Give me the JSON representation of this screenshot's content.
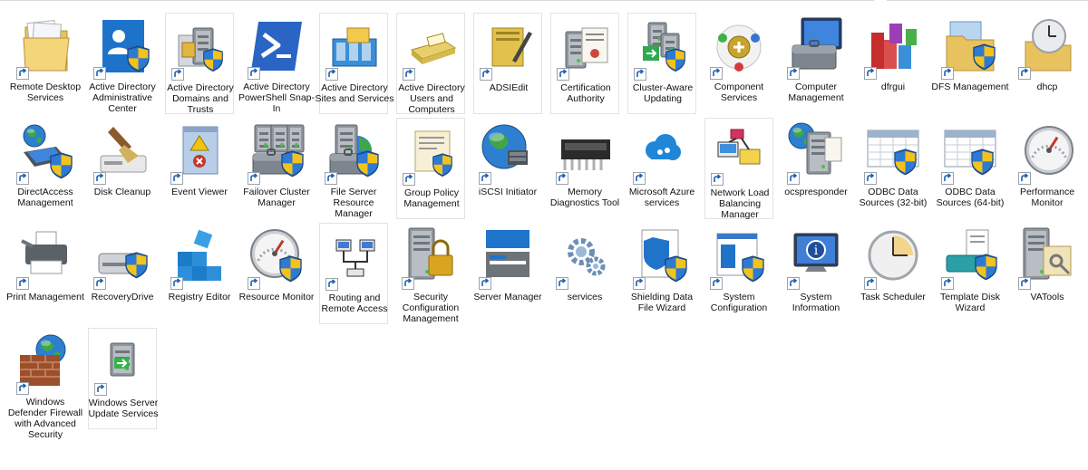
{
  "items": [
    {
      "label": "Remote Desktop Services",
      "icon": "folder-icon"
    },
    {
      "label": "Active Directory Administrative Center",
      "icon": "admin-center-icon"
    },
    {
      "label": "Active Directory Domains and Trusts",
      "icon": "domains-trusts-icon"
    },
    {
      "label": "Active Directory PowerShell Snap-In",
      "icon": "powershell-icon"
    },
    {
      "label": "Active Directory Sites and Services",
      "icon": "sites-services-icon"
    },
    {
      "label": "Active Directory Users and Computers",
      "icon": "users-computers-icon"
    },
    {
      "label": "ADSIEdit",
      "icon": "adsiedit-icon"
    },
    {
      "label": "Certification Authority",
      "icon": "certificate-server-icon"
    },
    {
      "label": "Cluster-Aware Updating",
      "icon": "cluster-update-icon"
    },
    {
      "label": "Component Services",
      "icon": "component-services-icon"
    },
    {
      "label": "Computer Management",
      "icon": "computer-management-icon"
    },
    {
      "label": "dfrgui",
      "icon": "defrag-icon"
    },
    {
      "label": "DFS Management",
      "icon": "dfs-folder-icon"
    },
    {
      "label": "dhcp",
      "icon": "dhcp-clock-folder-icon"
    },
    {
      "label": "DirectAccess Management",
      "icon": "laptop-globe-icon"
    },
    {
      "label": "Disk Cleanup",
      "icon": "disk-cleanup-icon"
    },
    {
      "label": "Event Viewer",
      "icon": "event-viewer-icon"
    },
    {
      "label": "Failover Cluster Manager",
      "icon": "failover-cluster-icon"
    },
    {
      "label": "File Server Resource Manager",
      "icon": "file-server-icon"
    },
    {
      "label": "Group Policy Management",
      "icon": "group-policy-icon"
    },
    {
      "label": "iSCSI Initiator",
      "icon": "iscsi-globe-icon"
    },
    {
      "label": "Memory Diagnostics Tool",
      "icon": "memory-chip-icon"
    },
    {
      "label": "Microsoft Azure services",
      "icon": "azure-cloud-icon"
    },
    {
      "label": "Network Load Balancing Manager",
      "icon": "network-load-balancing-icon"
    },
    {
      "label": "ocspresponder",
      "icon": "ocsp-server-icon"
    },
    {
      "label": "ODBC Data Sources (32-bit)",
      "icon": "odbc-table-icon"
    },
    {
      "label": "ODBC Data Sources (64-bit)",
      "icon": "odbc-table-icon"
    },
    {
      "label": "Performance Monitor",
      "icon": "gauge-icon"
    },
    {
      "label": "Print Management",
      "icon": "printer-icon"
    },
    {
      "label": "RecoveryDrive",
      "icon": "recovery-drive-icon"
    },
    {
      "label": "Registry Editor",
      "icon": "registry-cubes-icon"
    },
    {
      "label": "Resource Monitor",
      "icon": "resource-gauge-icon"
    },
    {
      "label": "Routing and Remote Access",
      "icon": "routing-network-icon"
    },
    {
      "label": "Security Configuration Management",
      "icon": "security-lock-server-icon"
    },
    {
      "label": "Server Manager",
      "icon": "server-manager-icon"
    },
    {
      "label": "services",
      "icon": "gears-icon"
    },
    {
      "label": "Shielding Data File Wizard",
      "icon": "shield-file-icon"
    },
    {
      "label": "System Configuration",
      "icon": "system-configuration-icon"
    },
    {
      "label": "System Information",
      "icon": "system-information-icon"
    },
    {
      "label": "Task Scheduler",
      "icon": "clock-icon"
    },
    {
      "label": "Template Disk Wizard",
      "icon": "template-disk-icon"
    },
    {
      "label": "VATools",
      "icon": "vatools-server-keys-icon"
    },
    {
      "label": "Windows Defender Firewall with Advanced Security",
      "icon": "firewall-globe-icon"
    },
    {
      "label": "Windows Server Update Services",
      "icon": "update-services-icon"
    }
  ]
}
